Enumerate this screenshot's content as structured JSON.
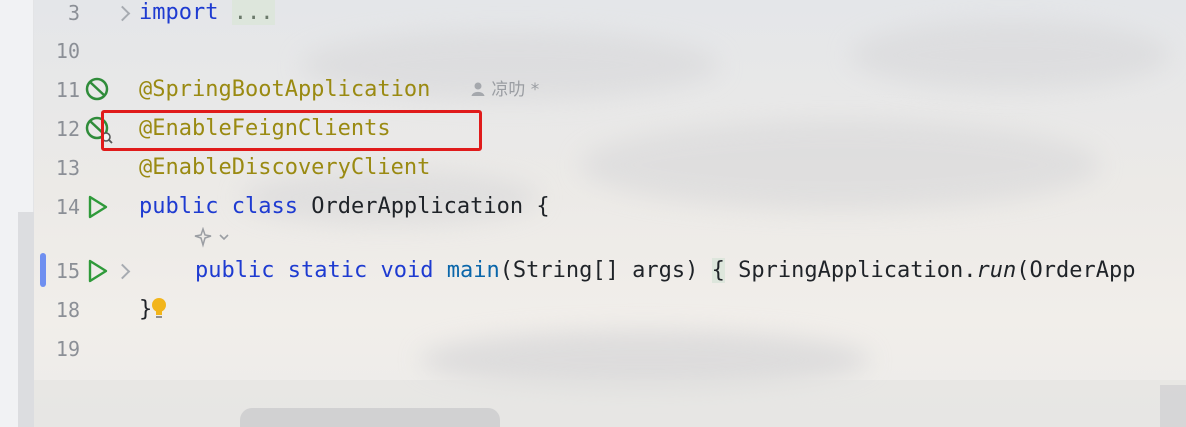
{
  "editor": {
    "lines": [
      {
        "num": "3",
        "code": "import",
        "folded": "..."
      },
      {
        "num": "10",
        "code": ""
      },
      {
        "num": "11",
        "code": "@SpringBootApplication",
        "gutter_icon": "spring-bean-icon"
      },
      {
        "num": "12",
        "code": "@EnableFeignClients",
        "gutter_icon": "spring-bean-search-icon"
      },
      {
        "num": "13",
        "code": "@EnableDiscoveryClient"
      },
      {
        "num": "14",
        "kw1": "public",
        "kw2": "class",
        "name": "OrderApplication",
        "brace": " {",
        "gutter_icon": "run-icon"
      },
      {
        "num": "15",
        "kw1": "public",
        "kw2": "static",
        "kw3": "void",
        "method": "main",
        "params": "(String[] args) ",
        "body_open": "{",
        "body": " SpringApplication.",
        "call": "run",
        "call_args": "(OrderApp",
        "gutter_icon": "run-icon"
      },
      {
        "num": "18",
        "code": "}"
      },
      {
        "num": "19",
        "code": ""
      }
    ],
    "inlay_author": "凉叻 *",
    "inlay_icon": "user-icon",
    "ai_hint_icon": "sparkle-icon",
    "intention_icon": "lightbulb-icon",
    "highlight_color": "#e01b1b"
  }
}
